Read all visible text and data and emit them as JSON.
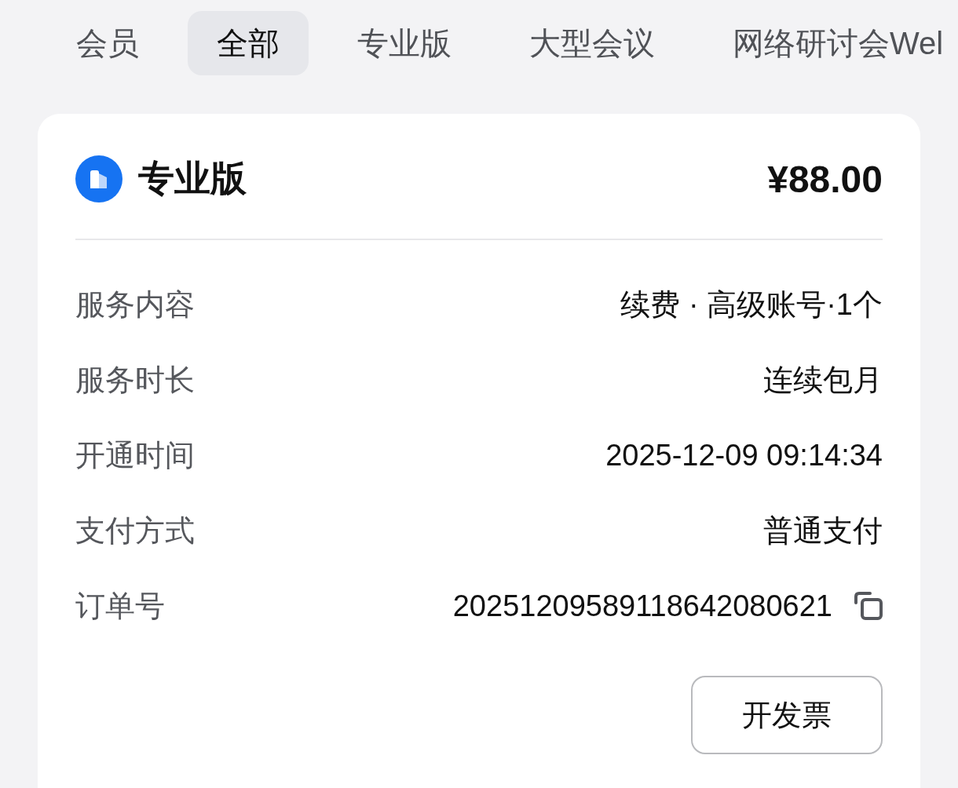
{
  "tabs": [
    {
      "label": "会员",
      "selected": false
    },
    {
      "label": "全部",
      "selected": true
    },
    {
      "label": "专业版",
      "selected": false
    },
    {
      "label": "大型会议",
      "selected": false
    },
    {
      "label": "网络研讨会Wel",
      "selected": false
    }
  ],
  "order": {
    "plan_name": "专业版",
    "price": "¥88.00",
    "details": [
      {
        "label": "服务内容",
        "value": "续费 · 高级账号·1个",
        "copyable": false
      },
      {
        "label": "服务时长",
        "value": "连续包月",
        "copyable": false
      },
      {
        "label": "开通时间",
        "value": "2025-12-09 09:14:34",
        "copyable": false
      },
      {
        "label": "支付方式",
        "value": "普通支付",
        "copyable": false
      },
      {
        "label": "订单号",
        "value": "20251209589118642080621",
        "copyable": true
      }
    ],
    "invoice_button": "开发票"
  }
}
